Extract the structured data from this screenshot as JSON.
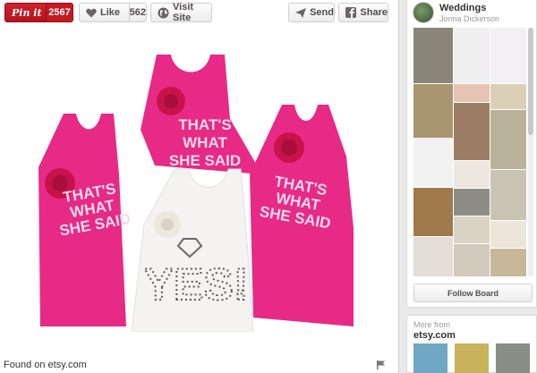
{
  "toolbar": {
    "pin_label": "Pin it",
    "pin_count": "2567",
    "like_label": "Like",
    "like_count": "562",
    "visit_label": "Visit Site",
    "send_label": "Send",
    "share_label": "Share"
  },
  "image": {
    "shirt_text_left": [
      "THAT'S",
      "WHAT",
      "SHE SAID"
    ],
    "shirt_text_center_top": [
      "THAT'S",
      "WHAT",
      "SHE SAID"
    ],
    "shirt_text_right": [
      "THAT'S",
      "WHAT",
      "SHE SAID"
    ],
    "shirt_text_white": "YES!"
  },
  "source": {
    "found_on": "Found on etsy.com"
  },
  "board": {
    "name": "Weddings",
    "owner": "Jonna Dickerson",
    "follow_label": "Follow Board"
  },
  "more": {
    "label": "More from",
    "site": "etsy.com"
  },
  "colors": {
    "pin_red": "#c41a22",
    "shirt_pink": "#e62a86",
    "flower_red": "#c8124a"
  }
}
